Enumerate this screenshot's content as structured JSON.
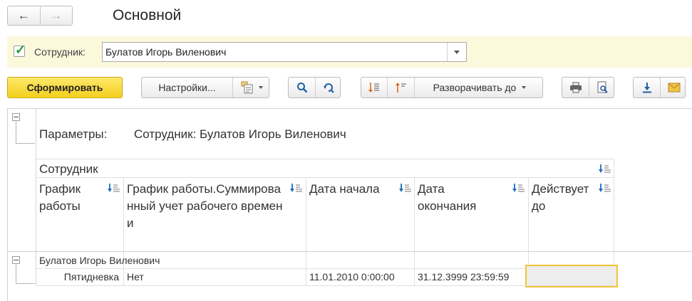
{
  "nav": {
    "back_icon": "arrow-left-icon",
    "forward_icon": "arrow-right-icon"
  },
  "page": {
    "title": "Основной"
  },
  "filter": {
    "enabled": true,
    "label": "Сотрудник:",
    "value": "Булатов Игорь Виленович"
  },
  "toolbar": {
    "generate_label": "Сформировать",
    "settings_label": "Настройки...",
    "expand_label": "Разворачивать до"
  },
  "report": {
    "params_label": "Параметры:",
    "params_value": "Сотрудник: Булатов Игорь Виленович",
    "group_header": "Сотрудник",
    "columns": [
      "График работы",
      "График работы.Суммированный учет рабочего времени",
      "Дата начала",
      "Дата окончания",
      "Действует до"
    ],
    "group_row": "Булатов Игорь Виленович",
    "rows": [
      {
        "schedule": "Пятидневка",
        "summarized": "Нет",
        "start": "11.01.2010 0:00:00",
        "end": "31.12.3999 23:59:59",
        "valid_until": ""
      }
    ]
  },
  "colors": {
    "accent": "#f5cf1d",
    "filter_bg": "#fbf8dc",
    "selection": "#f2c434",
    "check": "#1f9a36"
  }
}
